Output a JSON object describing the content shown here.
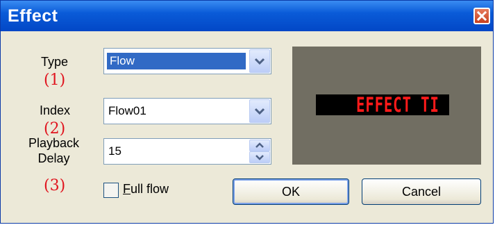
{
  "window": {
    "title": "Effect"
  },
  "form": {
    "type_label": "Type",
    "type_value": "Flow",
    "index_label": "Index",
    "index_value": "Flow01",
    "delay_label_line1": "Playback",
    "delay_label_line2": "Delay",
    "delay_value": "15",
    "full_flow_label_prefix": "F",
    "full_flow_label_rest": "ull flow",
    "full_flow_checked": false
  },
  "annotations": {
    "mark1": "(1)",
    "mark2": "(2)",
    "mark3": "(3)"
  },
  "preview": {
    "text": "EFFECT TI",
    "text_color": "#ff1a1a",
    "background": "#000000"
  },
  "buttons": {
    "ok": "OK",
    "cancel": "Cancel"
  },
  "icons": {
    "close": "close-icon",
    "dropdown": "chevron-down-icon",
    "spin_up": "arrow-up-icon",
    "spin_down": "arrow-down-icon"
  }
}
